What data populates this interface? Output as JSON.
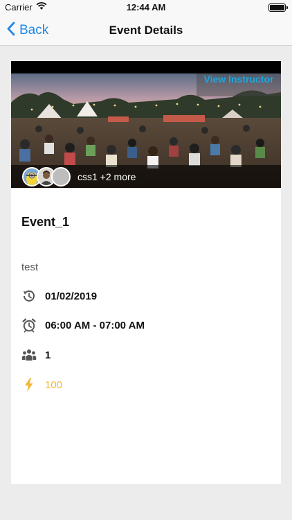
{
  "status_bar": {
    "carrier": "Carrier",
    "time": "12:44 AM"
  },
  "nav": {
    "back_label": "Back",
    "title": "Event Details"
  },
  "event": {
    "view_instructor_label": "View Instructor",
    "participants_text": "css1 +2 more",
    "title": "Event_1",
    "description": "test",
    "date": "01/02/2019",
    "time_range": "06:00 AM - 07:00 AM",
    "attendees": "1",
    "points": "100"
  },
  "colors": {
    "accent": "#1e88e5",
    "instructor_link": "#19a9e0",
    "points": "#f2b632"
  },
  "icons": {
    "date": "calendar-clock-icon",
    "time": "alarm-clock-icon",
    "attendees": "group-icon",
    "points": "lightning-icon"
  }
}
